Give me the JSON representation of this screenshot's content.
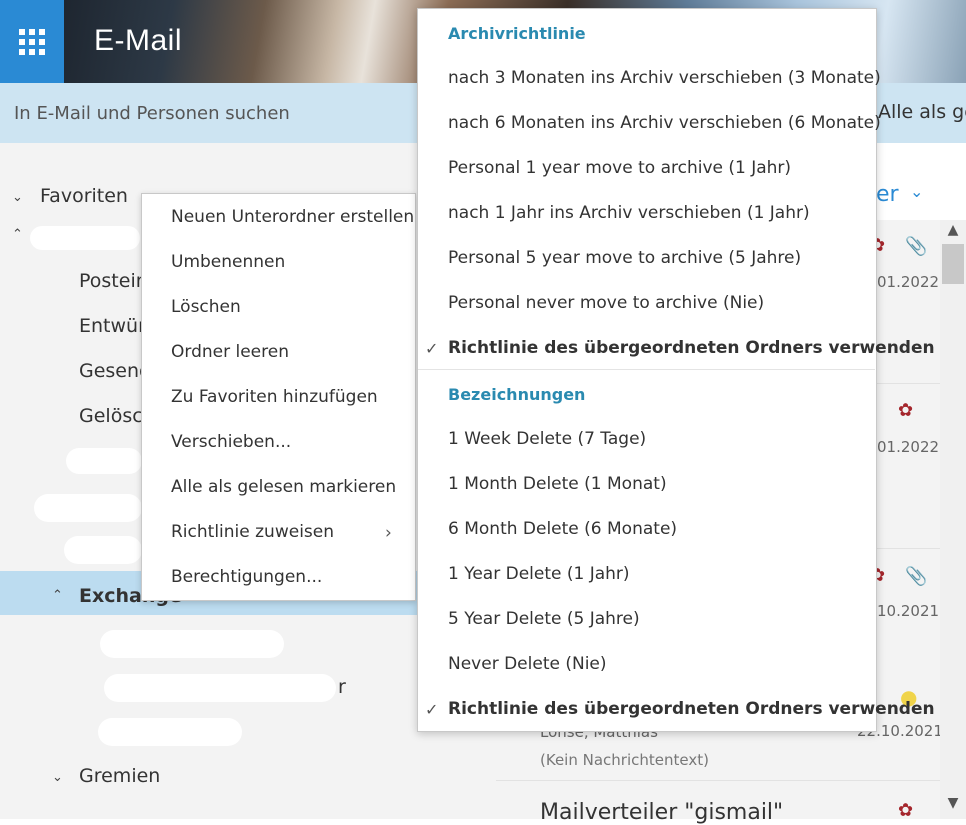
{
  "header": {
    "app_title": "E-Mail"
  },
  "search": {
    "placeholder": "In E-Mail und Personen suchen"
  },
  "toolbar": {
    "mark_all_read": "Alle als ge"
  },
  "folders": {
    "favorites": "Favoriten",
    "inbox": "Postein",
    "drafts": "Entwür",
    "sent": "Gesend",
    "deleted": "Gelösc",
    "exchange": "Exchange",
    "partial_label": "r",
    "gremien": "Gremien"
  },
  "messages": {
    "filter_label": "er",
    "dates": [
      "01.2022",
      "01.2022",
      "10.2021",
      "22.10.2021"
    ],
    "sender": "Lohse, Matthias",
    "preview": "(Kein Nachrichtentext)",
    "subject": "Mailverteiler \"gismail\""
  },
  "context_menu": {
    "items": [
      "Neuen Unterordner erstellen",
      "Umbenennen",
      "Löschen",
      "Ordner leeren",
      "Zu Favoriten hinzufügen",
      "Verschieben...",
      "Alle als gelesen markieren",
      "Richtlinie zuweisen",
      "Berechtigungen..."
    ]
  },
  "submenu": {
    "archive_heading": "Archivrichtlinie",
    "archive_items": [
      "nach 3 Monaten ins Archiv verschieben (3 Monate)",
      "nach 6 Monaten ins Archiv verschieben (6 Monate)",
      "Personal 1 year move to archive (1 Jahr)",
      "nach 1 Jahr ins Archiv verschieben (1 Jahr)",
      "Personal 5 year move to archive (5 Jahre)",
      "Personal never move to archive (Nie)",
      "Richtlinie des übergeordneten Ordners verwenden"
    ],
    "labels_heading": "Bezeichnungen",
    "label_items": [
      "1 Week Delete (7 Tage)",
      "1 Month Delete (1 Monat)",
      "6 Month Delete (6 Monate)",
      "1 Year Delete (1 Jahr)",
      "5 Year Delete (5 Jahre)",
      "Never Delete (Nie)",
      "Richtlinie des übergeordneten Ordners verwenden"
    ]
  },
  "colors": {
    "accent": "#2a8ad4",
    "search_bg": "#cde4f2",
    "selected_folder": "#bcdcf0",
    "submenu_heading": "#2a8ab0",
    "flag_red": "#a4262c"
  }
}
